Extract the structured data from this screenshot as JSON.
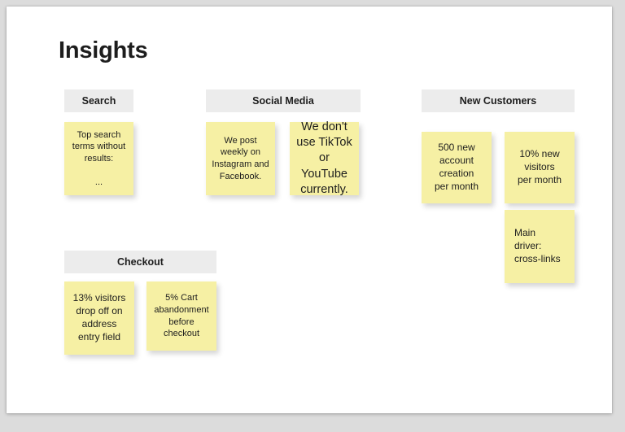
{
  "board": {
    "title": "Insights",
    "background_color": "#dcdcdc",
    "canvas_color": "#ffffff",
    "header_color": "#ececec",
    "note_color": "#f6f0a4",
    "text_color": "#1d1d1d"
  },
  "sections": [
    {
      "id": "search",
      "header": "Search",
      "notes": [
        {
          "id": "search-note-1",
          "text": "Top search\nterms without\nresults:\n\n..."
        }
      ]
    },
    {
      "id": "social-media",
      "header": "Social Media",
      "notes": [
        {
          "id": "social-note-1",
          "text": "We post\nweekly on\nInstagram and\nFacebook."
        },
        {
          "id": "social-note-2",
          "text": "We don't\nuse TikTok\nor YouTube\ncurrently."
        }
      ]
    },
    {
      "id": "new-customers",
      "header": "New Customers",
      "notes": [
        {
          "id": "new-customers-note-1",
          "text": "500 new\naccount\ncreation\nper month"
        },
        {
          "id": "new-customers-note-2",
          "text": "10% new\nvisitors\nper month"
        },
        {
          "id": "new-customers-note-3",
          "text": "Main\ndriver:\ncross-links"
        }
      ]
    },
    {
      "id": "checkout",
      "header": "Checkout",
      "notes": [
        {
          "id": "checkout-note-1",
          "text": "13% visitors\ndrop off on\naddress\nentry field"
        },
        {
          "id": "checkout-note-2",
          "text": "5% Cart\nabandonment\nbefore\ncheckout"
        }
      ]
    }
  ]
}
